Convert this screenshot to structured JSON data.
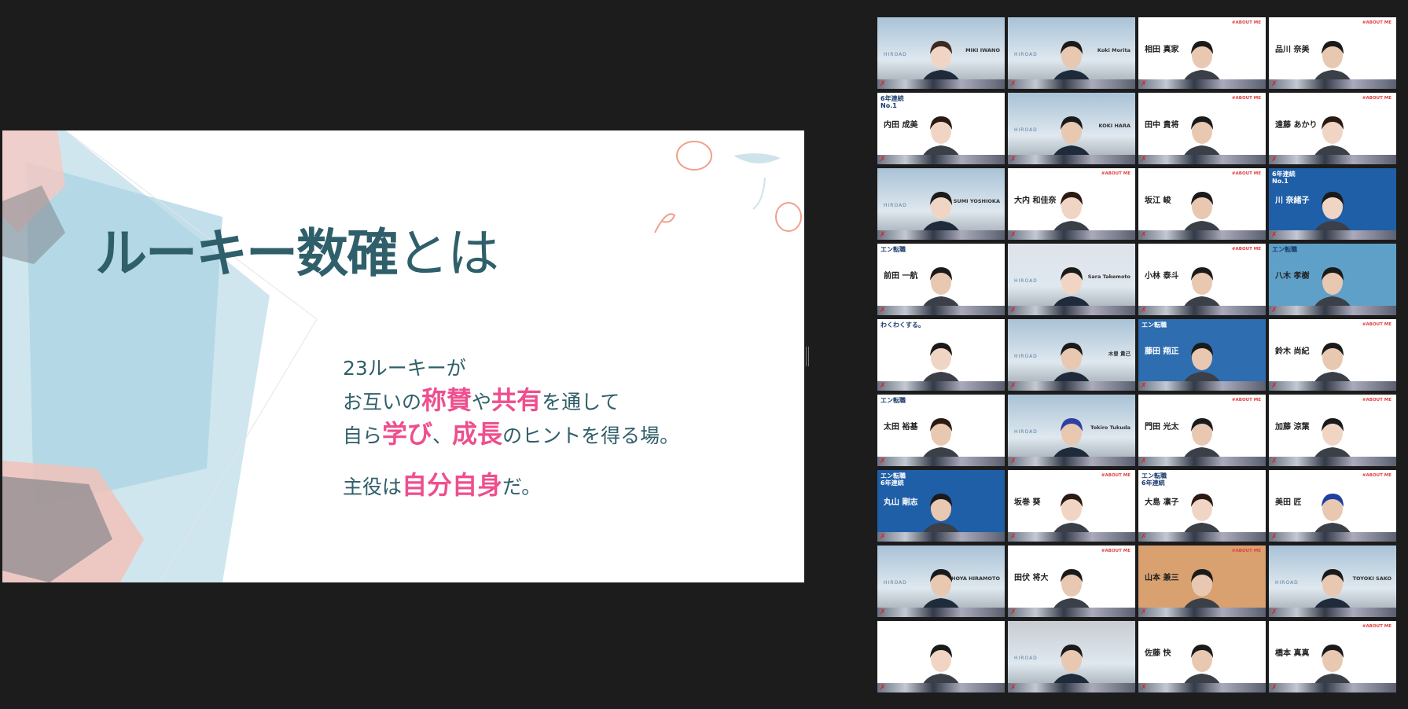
{
  "slide": {
    "title_bold": "ルーキー数確",
    "title_light": "とは",
    "line1": "23ルーキーが",
    "line2": [
      {
        "t": "お互いの",
        "hl": false
      },
      {
        "t": "称賛",
        "hl": true
      },
      {
        "t": "や",
        "hl": false
      },
      {
        "t": "共有",
        "hl": true
      },
      {
        "t": "を通して",
        "hl": false
      }
    ],
    "line3": [
      {
        "t": "自ら",
        "hl": false
      },
      {
        "t": "学び",
        "hl": true
      },
      {
        "t": "、",
        "hl": false
      },
      {
        "t": "成長",
        "hl": true
      },
      {
        "t": "のヒントを得る場。",
        "hl": false
      }
    ],
    "line4": [
      {
        "t": "主役は",
        "hl": false
      },
      {
        "t": "自分自身",
        "hl": true
      },
      {
        "t": "だ。",
        "hl": false
      }
    ],
    "colors": {
      "title": "#2f5f6a",
      "highlight": "#ee4f8e"
    }
  },
  "participants": [
    {
      "kind": "virtual",
      "name": "MIKI IWANO",
      "bg": "#a9c2d6",
      "skin": "#f1d5c4",
      "hair": "#3a2a20",
      "active": true
    },
    {
      "kind": "virtual",
      "name": "Koki Morita",
      "bg": "#a9c2d6",
      "skin": "#e8c8b0",
      "hair": "#1a1a1a"
    },
    {
      "kind": "profile",
      "bigname": "相田 真家",
      "about": "#ABOUT ME",
      "bg": "#ffffff",
      "skin": "#e8c8b0",
      "hair": "#1a1a1a"
    },
    {
      "kind": "profile",
      "bigname": "品川 奈美",
      "about": "#ABOUT ME",
      "bg": "#ffffff",
      "skin": "#e8c8b0",
      "hair": "#1a1a1a"
    },
    {
      "kind": "brand",
      "badge": "6年連続\nNo.1",
      "bigname": "内田 成美",
      "bg": "#ffffff",
      "skin": "#f1d5c4",
      "hair": "#2a1a12"
    },
    {
      "kind": "virtual",
      "name": "KOKI HARA",
      "bg": "#a9c2d6",
      "skin": "#e8c8b0",
      "hair": "#1a1a1a"
    },
    {
      "kind": "profile",
      "bigname": "田中 貴将",
      "about": "#ABOUT ME",
      "bg": "#ffffff",
      "skin": "#e8c8b0",
      "hair": "#1a1a1a"
    },
    {
      "kind": "profile",
      "bigname": "遠藤 あかり",
      "about": "#ABOUT ME",
      "bg": "#ffffff",
      "skin": "#f1d5c4",
      "hair": "#2a1a12"
    },
    {
      "kind": "virtual",
      "name": "SUMI YOSHIOKA",
      "bg": "#a9c2d6",
      "skin": "#f1d5c4",
      "hair": "#1a1a1a"
    },
    {
      "kind": "profile",
      "bigname": "大内 和佳奈",
      "about": "#ABOUT ME",
      "bg": "#ffffff",
      "skin": "#f1d5c4",
      "hair": "#2a1a12"
    },
    {
      "kind": "profile",
      "bigname": "坂江 峻",
      "about": "#ABOUT ME",
      "bg": "#ffffff",
      "skin": "#e8c8b0",
      "hair": "#1a1a1a"
    },
    {
      "kind": "brand",
      "badge": "6年連続\nNo.1",
      "bigname": "川 奈緒子",
      "bg": "#1f5fa8",
      "skin": "#f1d5c4",
      "hair": "#1a1a1a"
    },
    {
      "kind": "brand",
      "badge": "エン転職",
      "bigname": "前田 一航",
      "bg": "#ffffff",
      "skin": "#e8c8b0",
      "hair": "#1a1a1a"
    },
    {
      "kind": "virtual",
      "name": "Sara Takemoto",
      "bg": "#dfe3ea",
      "skin": "#f1d5c4",
      "hair": "#1a1a1a"
    },
    {
      "kind": "profile",
      "bigname": "小林 泰斗",
      "about": "#ABOUT ME",
      "bg": "#ffffff",
      "skin": "#e8c8b0",
      "hair": "#1a1a1a"
    },
    {
      "kind": "brand",
      "badge": "エン転職",
      "bigname": "八木 孝樹",
      "bg": "#5fa0c8",
      "skin": "#e8c8b0",
      "hair": "#1a1a1a"
    },
    {
      "kind": "brand",
      "badge": "わくわくする。",
      "bigname": "",
      "bg": "#ffffff",
      "skin": "#f1d5c4",
      "hair": "#1a1a1a"
    },
    {
      "kind": "virtual",
      "name": "木曽 貴己",
      "bg": "#a9c2d6",
      "skin": "#e8c8b0",
      "hair": "#1a1a1a"
    },
    {
      "kind": "brand",
      "badge": "エン転職",
      "bigname": "藤田 翔正",
      "bg": "#2d6db0",
      "skin": "#e8c8b0",
      "hair": "#1a1a1a"
    },
    {
      "kind": "profile",
      "bigname": "鈴木 尚紀",
      "about": "#ABOUT ME",
      "bg": "#ffffff",
      "skin": "#e8c8b0",
      "hair": "#1a1a1a"
    },
    {
      "kind": "brand",
      "badge": "エン転職",
      "bigname": "太田 裕基",
      "bg": "#ffffff",
      "skin": "#e8c8b0",
      "hair": "#2a1a12"
    },
    {
      "kind": "virtual",
      "name": "Tokiro Tukuda",
      "bg": "#a9c2d6",
      "skin": "#e8c8b0",
      "hair": "#3040a0"
    },
    {
      "kind": "profile",
      "bigname": "門田 光太",
      "about": "#ABOUT ME",
      "bg": "#ffffff",
      "skin": "#e8c8b0",
      "hair": "#1a1a1a"
    },
    {
      "kind": "profile",
      "bigname": "加藤 涼葉",
      "about": "#ABOUT ME",
      "bg": "#ffffff",
      "skin": "#f1d5c4",
      "hair": "#1a1a1a"
    },
    {
      "kind": "brand",
      "badge": "エン転職\n6年連続",
      "bigname": "丸山 剛志",
      "bg": "#1f5fa8",
      "skin": "#e8c8b0",
      "hair": "#1a1a1a"
    },
    {
      "kind": "profile",
      "bigname": "坂巻 葵",
      "about": "#ABOUT ME",
      "bg": "#ffffff",
      "skin": "#f1d5c4",
      "hair": "#2a1a12"
    },
    {
      "kind": "brand",
      "badge": "エン転職\n6年連続",
      "bigname": "大島 凛子",
      "bg": "#ffffff",
      "skin": "#f1d5c4",
      "hair": "#2a1a12"
    },
    {
      "kind": "profile",
      "bigname": "美田 匠",
      "about": "#ABOUT ME",
      "bg": "#ffffff",
      "skin": "#e8c8b0",
      "hair": "#2040a0"
    },
    {
      "kind": "virtual",
      "name": "SHOYA HIRAMOTO",
      "bg": "#a9c2d6",
      "skin": "#e8c8b0",
      "hair": "#1a1a1a"
    },
    {
      "kind": "profile",
      "bigname": "田伏 将大",
      "about": "#ABOUT ME",
      "bg": "#ffffff",
      "skin": "#e8c8b0",
      "hair": "#1a1a1a"
    },
    {
      "kind": "profile",
      "bigname": "山本 兼三",
      "about": "#ABOUT ME",
      "bg": "#d9a070",
      "skin": "#e8c8b0",
      "hair": "#1a1a1a"
    },
    {
      "kind": "virtual",
      "name": "TOYOKI SAKO",
      "bg": "#a9c2d6",
      "skin": "#e8c8b0",
      "hair": "#1a1a1a"
    },
    {
      "kind": "brand",
      "badge": "",
      "bigname": "",
      "bg": "#ffffff",
      "skin": "#f1d5c4",
      "hair": "#1a1a1a"
    },
    {
      "kind": "virtual",
      "name": "",
      "bg": "#c8ccd2",
      "skin": "#e8c8b0",
      "hair": "#1a1a1a"
    },
    {
      "kind": "profile",
      "bigname": "佐藤 快",
      "about": "",
      "bg": "#ffffff",
      "skin": "#e8c8b0",
      "hair": "#1a1a1a"
    },
    {
      "kind": "profile",
      "bigname": "橋本 真真",
      "about": "#ABOUT ME",
      "bg": "#ffffff",
      "skin": "#e8c8b0",
      "hair": "#1a1a1a"
    }
  ]
}
